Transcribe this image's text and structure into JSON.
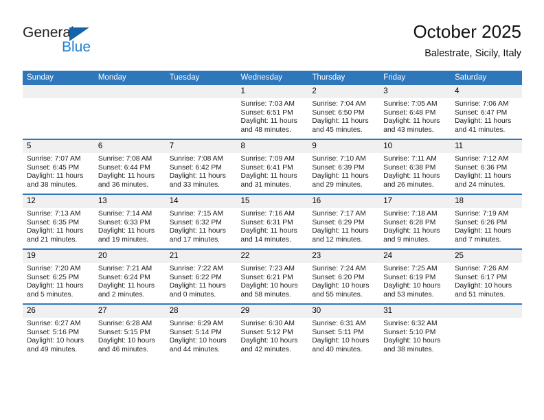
{
  "brand": {
    "name_part1": "General",
    "name_part2": "Blue",
    "triangle_color": "#1464aa",
    "blue_color": "#1a7fd4"
  },
  "header": {
    "title": "October 2025",
    "location": "Balestrate, Sicily, Italy"
  },
  "theme": {
    "header_blue": "#2e77bb",
    "daynum_gray": "#f0f0f0"
  },
  "weekdays": [
    "Sunday",
    "Monday",
    "Tuesday",
    "Wednesday",
    "Thursday",
    "Friday",
    "Saturday"
  ],
  "weeks": [
    [
      {
        "day": "",
        "empty": true,
        "sunrise": "",
        "sunset": "",
        "daylight1": "",
        "daylight2": ""
      },
      {
        "day": "",
        "empty": true,
        "sunrise": "",
        "sunset": "",
        "daylight1": "",
        "daylight2": ""
      },
      {
        "day": "",
        "empty": true,
        "sunrise": "",
        "sunset": "",
        "daylight1": "",
        "daylight2": ""
      },
      {
        "day": "1",
        "empty": false,
        "sunrise": "Sunrise: 7:03 AM",
        "sunset": "Sunset: 6:51 PM",
        "daylight1": "Daylight: 11 hours",
        "daylight2": "and 48 minutes."
      },
      {
        "day": "2",
        "empty": false,
        "sunrise": "Sunrise: 7:04 AM",
        "sunset": "Sunset: 6:50 PM",
        "daylight1": "Daylight: 11 hours",
        "daylight2": "and 45 minutes."
      },
      {
        "day": "3",
        "empty": false,
        "sunrise": "Sunrise: 7:05 AM",
        "sunset": "Sunset: 6:48 PM",
        "daylight1": "Daylight: 11 hours",
        "daylight2": "and 43 minutes."
      },
      {
        "day": "4",
        "empty": false,
        "sunrise": "Sunrise: 7:06 AM",
        "sunset": "Sunset: 6:47 PM",
        "daylight1": "Daylight: 11 hours",
        "daylight2": "and 41 minutes."
      }
    ],
    [
      {
        "day": "5",
        "empty": false,
        "sunrise": "Sunrise: 7:07 AM",
        "sunset": "Sunset: 6:45 PM",
        "daylight1": "Daylight: 11 hours",
        "daylight2": "and 38 minutes."
      },
      {
        "day": "6",
        "empty": false,
        "sunrise": "Sunrise: 7:08 AM",
        "sunset": "Sunset: 6:44 PM",
        "daylight1": "Daylight: 11 hours",
        "daylight2": "and 36 minutes."
      },
      {
        "day": "7",
        "empty": false,
        "sunrise": "Sunrise: 7:08 AM",
        "sunset": "Sunset: 6:42 PM",
        "daylight1": "Daylight: 11 hours",
        "daylight2": "and 33 minutes."
      },
      {
        "day": "8",
        "empty": false,
        "sunrise": "Sunrise: 7:09 AM",
        "sunset": "Sunset: 6:41 PM",
        "daylight1": "Daylight: 11 hours",
        "daylight2": "and 31 minutes."
      },
      {
        "day": "9",
        "empty": false,
        "sunrise": "Sunrise: 7:10 AM",
        "sunset": "Sunset: 6:39 PM",
        "daylight1": "Daylight: 11 hours",
        "daylight2": "and 29 minutes."
      },
      {
        "day": "10",
        "empty": false,
        "sunrise": "Sunrise: 7:11 AM",
        "sunset": "Sunset: 6:38 PM",
        "daylight1": "Daylight: 11 hours",
        "daylight2": "and 26 minutes."
      },
      {
        "day": "11",
        "empty": false,
        "sunrise": "Sunrise: 7:12 AM",
        "sunset": "Sunset: 6:36 PM",
        "daylight1": "Daylight: 11 hours",
        "daylight2": "and 24 minutes."
      }
    ],
    [
      {
        "day": "12",
        "empty": false,
        "sunrise": "Sunrise: 7:13 AM",
        "sunset": "Sunset: 6:35 PM",
        "daylight1": "Daylight: 11 hours",
        "daylight2": "and 21 minutes."
      },
      {
        "day": "13",
        "empty": false,
        "sunrise": "Sunrise: 7:14 AM",
        "sunset": "Sunset: 6:33 PM",
        "daylight1": "Daylight: 11 hours",
        "daylight2": "and 19 minutes."
      },
      {
        "day": "14",
        "empty": false,
        "sunrise": "Sunrise: 7:15 AM",
        "sunset": "Sunset: 6:32 PM",
        "daylight1": "Daylight: 11 hours",
        "daylight2": "and 17 minutes."
      },
      {
        "day": "15",
        "empty": false,
        "sunrise": "Sunrise: 7:16 AM",
        "sunset": "Sunset: 6:31 PM",
        "daylight1": "Daylight: 11 hours",
        "daylight2": "and 14 minutes."
      },
      {
        "day": "16",
        "empty": false,
        "sunrise": "Sunrise: 7:17 AM",
        "sunset": "Sunset: 6:29 PM",
        "daylight1": "Daylight: 11 hours",
        "daylight2": "and 12 minutes."
      },
      {
        "day": "17",
        "empty": false,
        "sunrise": "Sunrise: 7:18 AM",
        "sunset": "Sunset: 6:28 PM",
        "daylight1": "Daylight: 11 hours",
        "daylight2": "and 9 minutes."
      },
      {
        "day": "18",
        "empty": false,
        "sunrise": "Sunrise: 7:19 AM",
        "sunset": "Sunset: 6:26 PM",
        "daylight1": "Daylight: 11 hours",
        "daylight2": "and 7 minutes."
      }
    ],
    [
      {
        "day": "19",
        "empty": false,
        "sunrise": "Sunrise: 7:20 AM",
        "sunset": "Sunset: 6:25 PM",
        "daylight1": "Daylight: 11 hours",
        "daylight2": "and 5 minutes."
      },
      {
        "day": "20",
        "empty": false,
        "sunrise": "Sunrise: 7:21 AM",
        "sunset": "Sunset: 6:24 PM",
        "daylight1": "Daylight: 11 hours",
        "daylight2": "and 2 minutes."
      },
      {
        "day": "21",
        "empty": false,
        "sunrise": "Sunrise: 7:22 AM",
        "sunset": "Sunset: 6:22 PM",
        "daylight1": "Daylight: 11 hours",
        "daylight2": "and 0 minutes."
      },
      {
        "day": "22",
        "empty": false,
        "sunrise": "Sunrise: 7:23 AM",
        "sunset": "Sunset: 6:21 PM",
        "daylight1": "Daylight: 10 hours",
        "daylight2": "and 58 minutes."
      },
      {
        "day": "23",
        "empty": false,
        "sunrise": "Sunrise: 7:24 AM",
        "sunset": "Sunset: 6:20 PM",
        "daylight1": "Daylight: 10 hours",
        "daylight2": "and 55 minutes."
      },
      {
        "day": "24",
        "empty": false,
        "sunrise": "Sunrise: 7:25 AM",
        "sunset": "Sunset: 6:19 PM",
        "daylight1": "Daylight: 10 hours",
        "daylight2": "and 53 minutes."
      },
      {
        "day": "25",
        "empty": false,
        "sunrise": "Sunrise: 7:26 AM",
        "sunset": "Sunset: 6:17 PM",
        "daylight1": "Daylight: 10 hours",
        "daylight2": "and 51 minutes."
      }
    ],
    [
      {
        "day": "26",
        "empty": false,
        "sunrise": "Sunrise: 6:27 AM",
        "sunset": "Sunset: 5:16 PM",
        "daylight1": "Daylight: 10 hours",
        "daylight2": "and 49 minutes."
      },
      {
        "day": "27",
        "empty": false,
        "sunrise": "Sunrise: 6:28 AM",
        "sunset": "Sunset: 5:15 PM",
        "daylight1": "Daylight: 10 hours",
        "daylight2": "and 46 minutes."
      },
      {
        "day": "28",
        "empty": false,
        "sunrise": "Sunrise: 6:29 AM",
        "sunset": "Sunset: 5:14 PM",
        "daylight1": "Daylight: 10 hours",
        "daylight2": "and 44 minutes."
      },
      {
        "day": "29",
        "empty": false,
        "sunrise": "Sunrise: 6:30 AM",
        "sunset": "Sunset: 5:12 PM",
        "daylight1": "Daylight: 10 hours",
        "daylight2": "and 42 minutes."
      },
      {
        "day": "30",
        "empty": false,
        "sunrise": "Sunrise: 6:31 AM",
        "sunset": "Sunset: 5:11 PM",
        "daylight1": "Daylight: 10 hours",
        "daylight2": "and 40 minutes."
      },
      {
        "day": "31",
        "empty": false,
        "sunrise": "Sunrise: 6:32 AM",
        "sunset": "Sunset: 5:10 PM",
        "daylight1": "Daylight: 10 hours",
        "daylight2": "and 38 minutes."
      },
      {
        "day": "",
        "empty": true,
        "sunrise": "",
        "sunset": "",
        "daylight1": "",
        "daylight2": ""
      }
    ]
  ]
}
